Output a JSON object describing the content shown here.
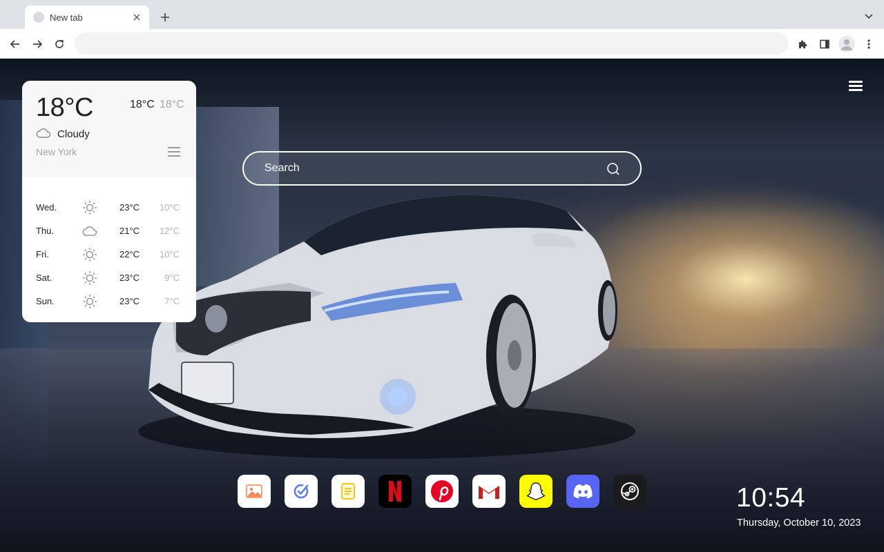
{
  "browser": {
    "tab_title": "New tab",
    "omnibox_value": ""
  },
  "weather": {
    "current_temp": "18°C",
    "high": "18°C",
    "low": "18°C",
    "condition": "Cloudy",
    "condition_icon": "cloud-icon",
    "city": "New York",
    "forecast": [
      {
        "day": "Wed.",
        "icon": "sun-icon",
        "high": "23°C",
        "low": "10°C"
      },
      {
        "day": "Thu.",
        "icon": "cloud-icon",
        "high": "21°C",
        "low": "12°C"
      },
      {
        "day": "Fri.",
        "icon": "sun-icon",
        "high": "22°C",
        "low": "10°C"
      },
      {
        "day": "Sat.",
        "icon": "sun-icon",
        "high": "23°C",
        "low": "9°C"
      },
      {
        "day": "Sun.",
        "icon": "sun-icon",
        "high": "23°C",
        "low": "7°C"
      }
    ]
  },
  "search": {
    "placeholder": "Search"
  },
  "dock": {
    "apps": [
      "gallery",
      "todo",
      "notes",
      "netflix",
      "pinterest",
      "gmail",
      "snapchat",
      "discord",
      "steam"
    ]
  },
  "clock": {
    "time": "10:54",
    "date": "Thursday, October 10, 2023"
  },
  "colors": {
    "netflix": "#e50914",
    "pinterest": "#e60023",
    "snapchat": "#fffc00",
    "discord": "#5865f2",
    "steam": "#1b1b1b",
    "todo_accent": "#5b7cf5",
    "notes_accent": "#f5c518"
  }
}
